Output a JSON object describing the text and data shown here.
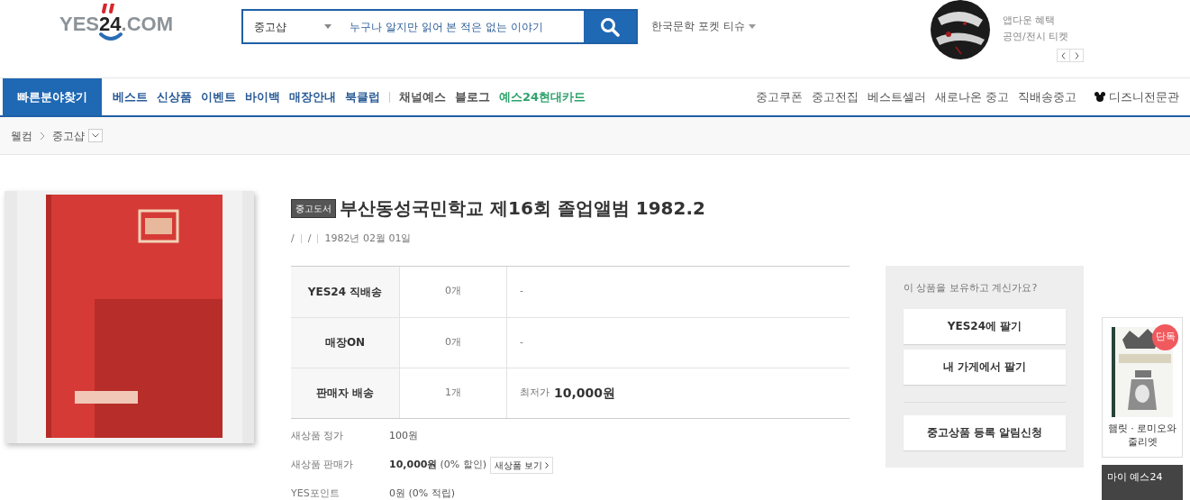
{
  "logo": {
    "left": "YES",
    "middle": "24",
    "right": ".COM"
  },
  "search": {
    "category": "중고샵",
    "placeholder": "누구나 알지만 읽어 본 적은 없는 이야기"
  },
  "keyword_link": "한국문학 포켓 티슈",
  "promo": {
    "lines": [
      "앱다운 혜택",
      "공연/전시 티켓"
    ]
  },
  "nav": {
    "quick_button": "빠른분야찾기",
    "main_items": [
      {
        "label": "베스트",
        "kind": "main"
      },
      {
        "label": "신상품",
        "kind": "main"
      },
      {
        "label": "이벤트",
        "kind": "main"
      },
      {
        "label": "바이백",
        "kind": "main"
      },
      {
        "label": "매장안내",
        "kind": "main"
      },
      {
        "label": "북클럽",
        "kind": "main"
      },
      {
        "label": "채널예스",
        "kind": "sub"
      },
      {
        "label": "블로그",
        "kind": "sub"
      },
      {
        "label": "예스24현대카드",
        "kind": "card"
      }
    ],
    "right_items": [
      "중고쿠폰",
      "중고전집",
      "베스트셀러",
      "새로나온 중고",
      "직배송중고"
    ],
    "disney": "디즈니전문관"
  },
  "breadcrumb": [
    "웰컴",
    "중고샵"
  ],
  "product": {
    "badge": "중고도서",
    "title": "부산동성국민학교 제16회 졸업앨범 1982.2",
    "meta": [
      "/",
      "/",
      "1982년 02월 01일"
    ],
    "stock_rows": [
      {
        "label": "YES24 직배송",
        "count": "0개",
        "info": "-"
      },
      {
        "label": "매장ON",
        "count": "0개",
        "info": "-"
      },
      {
        "label": "판매자 배송",
        "count": "1개",
        "info": "최저가",
        "price": "10,000원"
      }
    ],
    "price_rows": [
      {
        "label": "새상품 정가",
        "value": "100원"
      },
      {
        "label": "새상품 판매가",
        "value": "10,000원",
        "note": "(0% 할인)",
        "button": "새상품 보기"
      },
      {
        "label": "YES포인트",
        "value": "0원 (0% 적립)"
      }
    ]
  },
  "sell_box": {
    "question": "이 상품을 보유하고 계신가요?",
    "buttons": [
      "YES24에 팔기",
      "내 가게에서 팔기"
    ],
    "notify_button": "중고상품 등록 알림신청"
  },
  "side_widget": {
    "badge": "단독",
    "title": "햄릿 · 로미오와 줄리엣",
    "my_menu": "마이 예스24"
  }
}
